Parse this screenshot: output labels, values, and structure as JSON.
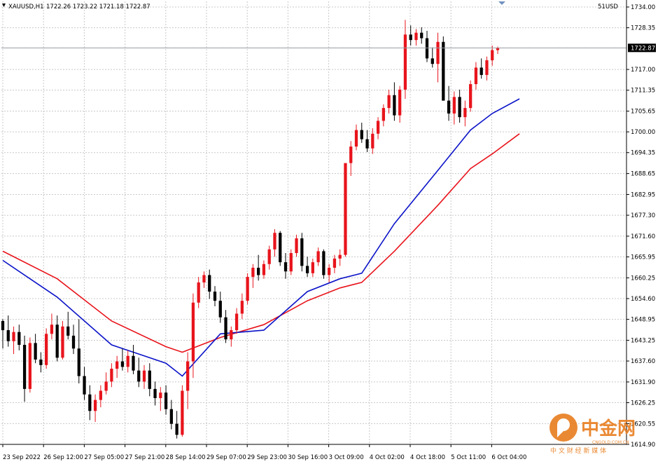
{
  "header": {
    "symbol": "XAUUSD,H1",
    "ohlc": "1722.26 1723.22 1721.18 1722.87",
    "indicator": "51USD"
  },
  "watermark": {
    "brand": "中金网",
    "sub": "中 文 财 经 新 媒 体",
    "url": "CNGOLD.COM.CN"
  },
  "colors": {
    "bull": "#e8141c",
    "bear": "#000000",
    "ma_fast": "#0c14c8",
    "ma_slow": "#e8141c",
    "price_bg": "#000000",
    "watermark": "#e87d1e"
  },
  "chart_data": {
    "type": "candlestick",
    "timeframe": "H1",
    "ylim": [
      1614.9,
      1734.0
    ],
    "y_ticks": [
      "1734.00",
      "1728.35",
      "1722.87",
      "1717.00",
      "1711.35",
      "1705.65",
      "1700.00",
      "1694.35",
      "1688.65",
      "1682.95",
      "1677.30",
      "1671.60",
      "1665.95",
      "1660.25",
      "1654.60",
      "1648.95",
      "1643.25",
      "1637.60",
      "1631.90",
      "1626.25",
      "1620.55",
      "1614.90"
    ],
    "x_ticks": [
      "23 Sep 2022",
      "26 Sep 12:00",
      "27 Sep 05:00",
      "27 Sep 21:00",
      "28 Sep 14:00",
      "29 Sep 07:00",
      "29 Sep 23:00",
      "30 Sep 16:00",
      "3 Oct 09:00",
      "4 Oct 02:00",
      "4 Oct 18:00",
      "5 Oct 11:00",
      "6 Oct 04:00"
    ],
    "current_price": 1722.87,
    "candles": [
      [
        1648.5,
        1649.0,
        1641.0,
        1646.0
      ],
      [
        1646.0,
        1650.0,
        1641.5,
        1643.0
      ],
      [
        1643.0,
        1647.0,
        1639.5,
        1645.5
      ],
      [
        1645.5,
        1647.5,
        1640.5,
        1642.0
      ],
      [
        1642.0,
        1644.5,
        1626.5,
        1630.0
      ],
      [
        1630.0,
        1644.0,
        1629.0,
        1642.5
      ],
      [
        1642.5,
        1645.0,
        1637.0,
        1638.0
      ],
      [
        1638.0,
        1640.0,
        1634.5,
        1636.5
      ],
      [
        1636.5,
        1646.5,
        1635.5,
        1645.0
      ],
      [
        1645.0,
        1650.5,
        1643.5,
        1647.5
      ],
      [
        1647.5,
        1650.0,
        1637.5,
        1638.5
      ],
      [
        1638.5,
        1648.5,
        1638.0,
        1647.0
      ],
      [
        1647.0,
        1651.0,
        1643.5,
        1644.5
      ],
      [
        1644.5,
        1647.5,
        1639.5,
        1641.0
      ],
      [
        1641.0,
        1649.0,
        1631.5,
        1633.5
      ],
      [
        1633.5,
        1636.0,
        1627.0,
        1628.5
      ],
      [
        1628.5,
        1631.0,
        1621.5,
        1624.0
      ],
      [
        1624.0,
        1628.5,
        1621.0,
        1627.0
      ],
      [
        1627.0,
        1631.0,
        1625.0,
        1629.5
      ],
      [
        1629.5,
        1634.5,
        1628.5,
        1632.0
      ],
      [
        1632.0,
        1637.0,
        1630.5,
        1635.5
      ],
      [
        1635.5,
        1639.0,
        1633.0,
        1637.5
      ],
      [
        1637.5,
        1641.0,
        1635.0,
        1636.0
      ],
      [
        1636.0,
        1640.5,
        1634.5,
        1639.0
      ],
      [
        1639.0,
        1642.0,
        1634.0,
        1635.0
      ],
      [
        1635.0,
        1638.5,
        1630.5,
        1632.0
      ],
      [
        1632.0,
        1636.5,
        1630.0,
        1635.0
      ],
      [
        1635.0,
        1637.0,
        1628.0,
        1630.0
      ],
      [
        1630.0,
        1632.0,
        1625.5,
        1627.5
      ],
      [
        1627.5,
        1630.5,
        1624.0,
        1629.0
      ],
      [
        1629.0,
        1631.0,
        1623.0,
        1624.5
      ],
      [
        1624.5,
        1627.0,
        1619.0,
        1620.5
      ],
      [
        1620.5,
        1624.0,
        1616.5,
        1617.5
      ],
      [
        1617.5,
        1631.0,
        1617.0,
        1629.5
      ],
      [
        1629.5,
        1640.0,
        1624.5,
        1637.5
      ],
      [
        1637.5,
        1656.0,
        1633.0,
        1653.5
      ],
      [
        1653.5,
        1660.5,
        1652.0,
        1659.0
      ],
      [
        1659.0,
        1662.0,
        1657.5,
        1661.0
      ],
      [
        1661.0,
        1662.5,
        1654.5,
        1656.5
      ],
      [
        1656.5,
        1658.0,
        1652.5,
        1654.0
      ],
      [
        1654.0,
        1656.5,
        1648.0,
        1649.5
      ],
      [
        1649.5,
        1651.5,
        1642.5,
        1643.5
      ],
      [
        1643.5,
        1647.0,
        1641.5,
        1646.0
      ],
      [
        1646.0,
        1652.0,
        1645.0,
        1650.5
      ],
      [
        1650.5,
        1656.0,
        1649.0,
        1654.0
      ],
      [
        1654.0,
        1661.5,
        1653.0,
        1660.5
      ],
      [
        1660.5,
        1664.0,
        1657.5,
        1663.0
      ],
      [
        1663.0,
        1666.5,
        1659.5,
        1661.0
      ],
      [
        1661.0,
        1665.0,
        1660.0,
        1664.0
      ],
      [
        1664.0,
        1669.0,
        1662.5,
        1668.0
      ],
      [
        1668.0,
        1673.5,
        1666.0,
        1672.5
      ],
      [
        1672.5,
        1673.0,
        1663.5,
        1664.5
      ],
      [
        1664.5,
        1667.0,
        1660.0,
        1662.0
      ],
      [
        1662.0,
        1668.0,
        1661.0,
        1667.0
      ],
      [
        1667.0,
        1672.0,
        1666.0,
        1671.0
      ],
      [
        1671.0,
        1672.5,
        1662.0,
        1663.5
      ],
      [
        1663.5,
        1666.0,
        1660.5,
        1661.5
      ],
      [
        1661.5,
        1665.5,
        1660.5,
        1664.5
      ],
      [
        1664.5,
        1668.5,
        1663.5,
        1667.5
      ],
      [
        1667.5,
        1668.0,
        1660.0,
        1661.0
      ],
      [
        1661.0,
        1664.0,
        1659.0,
        1663.0
      ],
      [
        1663.0,
        1666.5,
        1661.5,
        1665.5
      ],
      [
        1665.5,
        1668.0,
        1663.5,
        1666.5
      ],
      [
        1666.5,
        1676.0,
        1666.0,
        1691.5
      ],
      [
        1691.5,
        1697.5,
        1688.0,
        1696.0
      ],
      [
        1696.0,
        1702.0,
        1695.0,
        1700.5
      ],
      [
        1700.5,
        1702.5,
        1697.0,
        1698.0
      ],
      [
        1698.0,
        1700.5,
        1694.5,
        1695.5
      ],
      [
        1695.5,
        1701.0,
        1694.0,
        1699.5
      ],
      [
        1699.5,
        1704.0,
        1698.0,
        1703.0
      ],
      [
        1703.0,
        1707.5,
        1701.5,
        1706.5
      ],
      [
        1706.5,
        1711.5,
        1705.0,
        1710.0
      ],
      [
        1710.0,
        1713.5,
        1703.0,
        1704.5
      ],
      [
        1704.5,
        1712.5,
        1702.5,
        1711.5
      ],
      [
        1711.5,
        1730.5,
        1709.0,
        1726.5
      ],
      [
        1726.5,
        1729.0,
        1723.5,
        1725.0
      ],
      [
        1725.0,
        1728.0,
        1723.5,
        1727.0
      ],
      [
        1727.0,
        1728.5,
        1724.0,
        1725.5
      ],
      [
        1725.5,
        1727.5,
        1719.0,
        1720.0
      ],
      [
        1720.0,
        1723.0,
        1717.5,
        1718.5
      ],
      [
        1718.5,
        1727.0,
        1713.5,
        1724.5
      ],
      [
        1724.5,
        1726.0,
        1713.0,
        1708.5
      ],
      [
        1708.5,
        1712.5,
        1703.0,
        1705.0
      ],
      [
        1705.0,
        1711.0,
        1702.0,
        1709.5
      ],
      [
        1709.5,
        1711.5,
        1702.5,
        1704.0
      ],
      [
        1704.0,
        1708.5,
        1701.5,
        1706.5
      ],
      [
        1706.5,
        1714.0,
        1705.5,
        1713.0
      ],
      [
        1713.0,
        1719.0,
        1711.5,
        1717.5
      ],
      [
        1717.5,
        1720.0,
        1714.5,
        1715.5
      ],
      [
        1715.5,
        1720.5,
        1714.0,
        1719.5
      ],
      [
        1719.5,
        1723.5,
        1718.0,
        1722.26
      ],
      [
        1722.26,
        1723.22,
        1721.18,
        1722.87
      ]
    ],
    "ma_fast": [
      [
        0,
        1665.0
      ],
      [
        10,
        1655.0
      ],
      [
        20,
        1642.0
      ],
      [
        30,
        1637.0
      ],
      [
        33,
        1633.5
      ],
      [
        40,
        1645.0
      ],
      [
        48,
        1646.0
      ],
      [
        56,
        1656.5
      ],
      [
        62,
        1660.0
      ],
      [
        66,
        1661.5
      ],
      [
        72,
        1675.0
      ],
      [
        80,
        1689.5
      ],
      [
        86,
        1700.5
      ],
      [
        90,
        1705.0
      ],
      [
        95,
        1709.0
      ]
    ],
    "ma_slow": [
      [
        0,
        1667.5
      ],
      [
        10,
        1660.0
      ],
      [
        20,
        1648.5
      ],
      [
        30,
        1641.5
      ],
      [
        33,
        1640.0
      ],
      [
        40,
        1644.0
      ],
      [
        48,
        1647.5
      ],
      [
        56,
        1654.0
      ],
      [
        62,
        1657.5
      ],
      [
        66,
        1659.0
      ],
      [
        72,
        1667.5
      ],
      [
        80,
        1680.0
      ],
      [
        86,
        1690.0
      ],
      [
        90,
        1694.0
      ],
      [
        95,
        1699.5
      ]
    ]
  }
}
